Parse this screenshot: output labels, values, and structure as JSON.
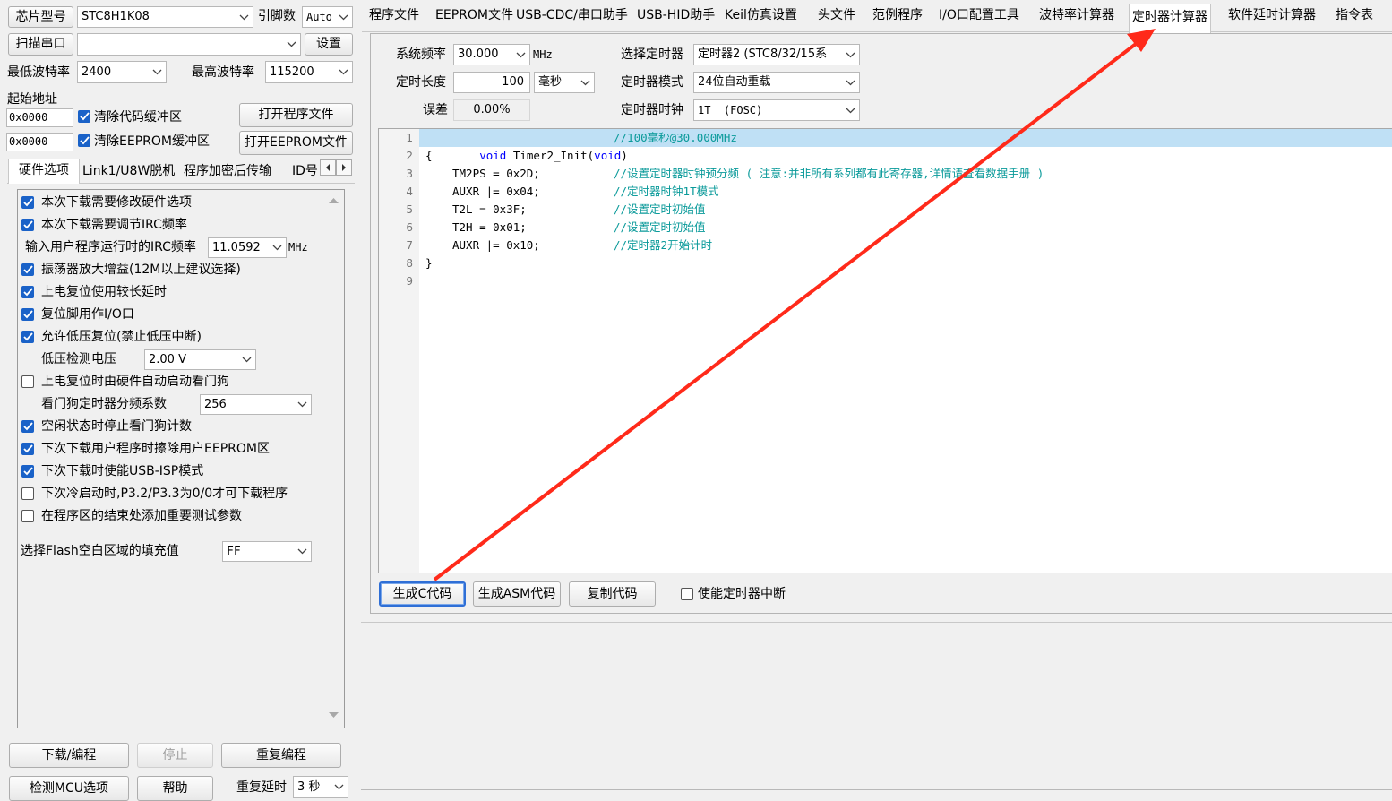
{
  "left": {
    "chip_model_label": "芯片型号",
    "chip_model_value": "STC8H1K08",
    "pins_label": "引脚数",
    "pins_value": "Auto",
    "scan_port_label": "扫描串口",
    "port_value": "",
    "settings_label": "设置",
    "min_baud_label": "最低波特率",
    "min_baud_value": "2400",
    "max_baud_label": "最高波特率",
    "max_baud_value": "115200",
    "start_addr_label": "起始地址",
    "code_addr_value": "0x0000",
    "clear_code_buf_label": "清除代码缓冲区",
    "open_program_label": "打开程序文件",
    "eeprom_addr_value": "0x0000",
    "clear_eeprom_buf_label": "清除EEPROM缓冲区",
    "open_eeprom_label": "打开EEPROM文件",
    "subtabs": [
      "硬件选项",
      "Link1/U8W脱机",
      "程序加密后传输",
      "ID号"
    ],
    "options": [
      {
        "label": "本次下载需要修改硬件选项",
        "checked": true
      },
      {
        "label": "本次下载需要调节IRC频率",
        "checked": true
      },
      {
        "label": "振荡器放大增益(12M以上建议选择)",
        "checked": true
      },
      {
        "label": "上电复位使用较长延时",
        "checked": true
      },
      {
        "label": "复位脚用作I/O口",
        "checked": true
      },
      {
        "label": "允许低压复位(禁止低压中断)",
        "checked": true
      },
      {
        "label": "上电复位时由硬件自动启动看门狗",
        "checked": false
      },
      {
        "label": "空闲状态时停止看门狗计数",
        "checked": true
      },
      {
        "label": "下次下载用户程序时擦除用户EEPROM区",
        "checked": true
      },
      {
        "label": "下次下载时使能USB-ISP模式",
        "checked": true
      },
      {
        "label": "下次冷启动时,P3.2/P3.3为0/0才可下载程序",
        "checked": false
      },
      {
        "label": "在程序区的结束处添加重要测试参数",
        "checked": false
      }
    ],
    "irc_label": "输入用户程序运行时的IRC频率",
    "irc_value": "11.0592",
    "irc_unit": "MHz",
    "lvd_label": "低压检测电压",
    "lvd_value": "2.00 V",
    "wdt_label": "看门狗定时器分频系数",
    "wdt_value": "256",
    "flash_fill_label": "选择Flash空白区域的填充值",
    "flash_fill_value": "FF",
    "download_label": "下载/编程",
    "stop_label": "停止",
    "reprogram_label": "重复编程",
    "detect_label": "检测MCU选项",
    "help_label": "帮助",
    "repeat_delay_label": "重复延时",
    "repeat_delay_value": "3 秒"
  },
  "tabs": [
    "程序文件",
    "EEPROM文件",
    "USB-CDC/串口助手",
    "USB-HID助手",
    "Keil仿真设置",
    "头文件",
    "范例程序",
    "I/O口配置工具",
    "波特率计算器",
    "定时器计算器",
    "软件延时计算器",
    "指令表"
  ],
  "active_tab": "定时器计算器",
  "timer": {
    "sys_freq_label": "系统频率",
    "sys_freq_value": "30.000",
    "sys_freq_unit": "MHz",
    "select_timer_label": "选择定时器",
    "select_timer_value": "定时器2 (STC8/32/15系",
    "length_label": "定时长度",
    "length_value": "100",
    "length_unit": "毫秒",
    "mode_label": "定时器模式",
    "mode_value": "24位自动重载",
    "error_label": "误差",
    "error_value": "0.00%",
    "clock_label": "定时器时钟",
    "clock_value": "1T  (FOSC)"
  },
  "code": {
    "line_numbers": [
      "1",
      "2",
      "3",
      "4",
      "5",
      "6",
      "7",
      "8",
      "9"
    ],
    "line1_kw1": "void",
    "line1_fn": " Timer2_Init(",
    "line1_kw2": "void",
    "line1_end": ")",
    "line1_comment": "//100毫秒@30.000MHz",
    "line2": "{",
    "line3_code": "TM2PS = 0x2D;",
    "line3_comment": "//设置定时器时钟预分频 ( 注意:并非所有系列都有此寄存器,详情请查看数据手册 )",
    "line4_code": "AUXR |= 0x04;",
    "line4_comment": "//定时器时钟1T模式",
    "line5_code": "T2L = 0x3F;",
    "line5_comment": "//设置定时初始值",
    "line6_code": "T2H = 0x01;",
    "line6_comment": "//设置定时初始值",
    "line7_code": "AUXR |= 0x10;",
    "line7_comment": "//定时器2开始计时",
    "line8": "}"
  },
  "actions": {
    "gen_c_label": "生成C代码",
    "gen_asm_label": "生成ASM代码",
    "copy_label": "复制代码",
    "enable_int_label": "使能定时器中断"
  },
  "annotation_color": "#ff2a1a"
}
